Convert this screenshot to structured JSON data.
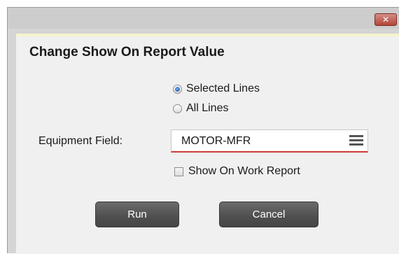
{
  "dialog": {
    "close_glyph": "✕",
    "heading": "Change Show On Report Value"
  },
  "scope": {
    "options": [
      {
        "label": "Selected Lines",
        "checked": true
      },
      {
        "label": "All Lines",
        "checked": false
      }
    ]
  },
  "equipment_field": {
    "label": "Equipment Field:",
    "value": "MOTOR-MFR",
    "menu_icon": "hamburger-menu-icon"
  },
  "show_on_work_report": {
    "label": "Show On Work Report",
    "checked": false
  },
  "buttons": {
    "run": "Run",
    "cancel": "Cancel"
  },
  "colors": {
    "close_button": "#b2463a",
    "button_bg": "#555555",
    "input_underline": "#d03a3a",
    "selected_radio": "#1e5aa8"
  }
}
